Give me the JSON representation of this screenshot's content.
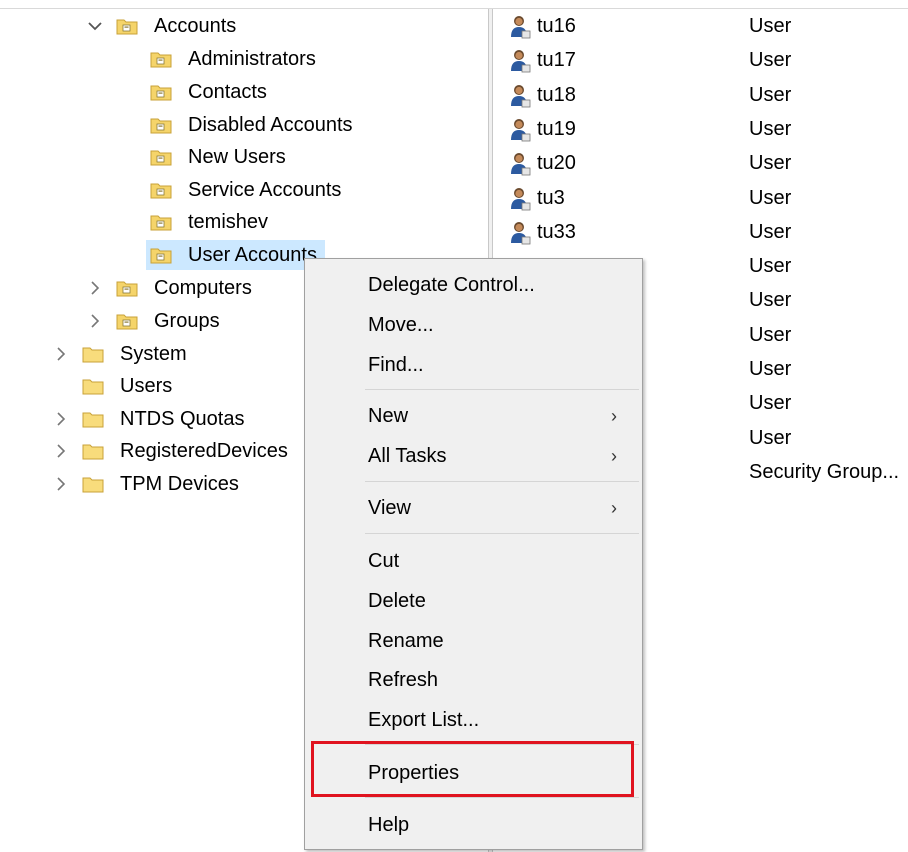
{
  "tree": {
    "accounts": "Accounts",
    "children": [
      "Administrators",
      "Contacts",
      "Disabled Accounts",
      "New Users",
      "Service Accounts",
      "temishev",
      "User Accounts"
    ],
    "computers": "Computers",
    "groups": "Groups",
    "root_items": [
      "System",
      "Users",
      "NTDS Quotas",
      "RegisteredDevices",
      "TPM Devices"
    ]
  },
  "list": {
    "rows": [
      {
        "name": "tu16",
        "type": "User"
      },
      {
        "name": "tu17",
        "type": "User"
      },
      {
        "name": "tu18",
        "type": "User"
      },
      {
        "name": "tu19",
        "type": "User"
      },
      {
        "name": "tu20",
        "type": "User"
      },
      {
        "name": "tu3",
        "type": "User"
      },
      {
        "name": "tu33",
        "type": "User"
      },
      {
        "name": "",
        "type": "User"
      },
      {
        "name": "",
        "type": "User"
      },
      {
        "name": "",
        "type": "User"
      },
      {
        "name": "",
        "type": "User"
      },
      {
        "name": "",
        "type": "User"
      },
      {
        "name": "",
        "type": "User"
      },
      {
        "name": "",
        "type": "Security Group..."
      }
    ]
  },
  "context_menu": {
    "delegate_control": "Delegate Control...",
    "move": "Move...",
    "find": "Find...",
    "new": "New",
    "all_tasks": "All Tasks",
    "view": "View",
    "cut": "Cut",
    "delete": "Delete",
    "rename": "Rename",
    "refresh": "Refresh",
    "export_list": "Export List...",
    "properties": "Properties",
    "help": "Help"
  },
  "colors": {
    "selection": "#cce8ff",
    "highlight_box": "#e0131f",
    "menu_bg": "#f0f0f0"
  }
}
